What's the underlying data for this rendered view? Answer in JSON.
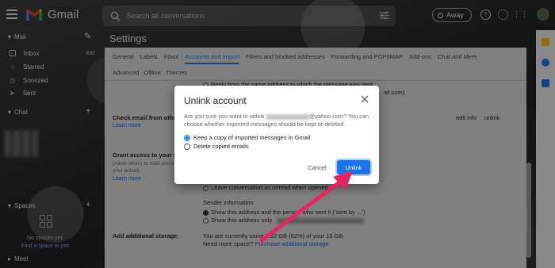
{
  "app": {
    "name": "Gmail"
  },
  "search": {
    "placeholder": "Search all conversations"
  },
  "status": {
    "label": "Away"
  },
  "nav": {
    "mail_section": "Mail",
    "items": [
      {
        "label": "Inbox",
        "count": "630"
      },
      {
        "label": "Starred"
      },
      {
        "label": "Snoozed"
      },
      {
        "label": "Sent"
      }
    ],
    "chat_section": "Chat",
    "spaces_section": "Spaces",
    "no_spaces_text": "No spaces yet",
    "find_space_link": "Find a space to join",
    "meet_section": "Meet"
  },
  "settings": {
    "title": "Settings",
    "tabs_row1": [
      "General",
      "Labels",
      "Inbox",
      "Accounts and Import",
      "Filters and blocked addresses",
      "Forwarding and POP/IMAP",
      "Add-ons",
      "Chat and Meet"
    ],
    "active_tab": "Accounts and Import",
    "tabs_row2": [
      "Advanced",
      "Offline",
      "Themes"
    ],
    "reply_from_text": "Reply from the same address to which the message was sent",
    "ail_text": "ail.com)",
    "check_email_label": "Check email from othe",
    "learn_more": "Learn more",
    "edit_info": "edit info",
    "unlink": "unlink",
    "grant_access_label": "Grant access to your ac",
    "grant_sub1": "(Allow others to read and s",
    "grant_sub2": "your behalf)",
    "leave_unread": "Leave conversation as unread when opened",
    "sender_info": "Sender information",
    "sender_opt1": "Show this address and the person who sent it (‘sent by ...’)",
    "sender_opt2": "Show this address only",
    "storage_label": "Add additional storage:",
    "storage_text": "You are currently using 9.32 GB (62%) of your 15 GB.",
    "need_more": "Need more space?",
    "purchase_link": "Purchase additional storage"
  },
  "dialog": {
    "title": "Unlink account",
    "message_prefix": "Are you sure you want to unlink",
    "message_suffix": "@yahoo.com? You can choose whether imported messages should be kept or deleted.",
    "option_keep": "Keep a copy of imported messages in Gmail",
    "option_delete": "Delete copied emails",
    "selected_option": "keep",
    "cancel_label": "Cancel",
    "unlink_label": "Unlink"
  },
  "colors": {
    "accent": "#1a73e8",
    "arrow": "#e6245e"
  }
}
